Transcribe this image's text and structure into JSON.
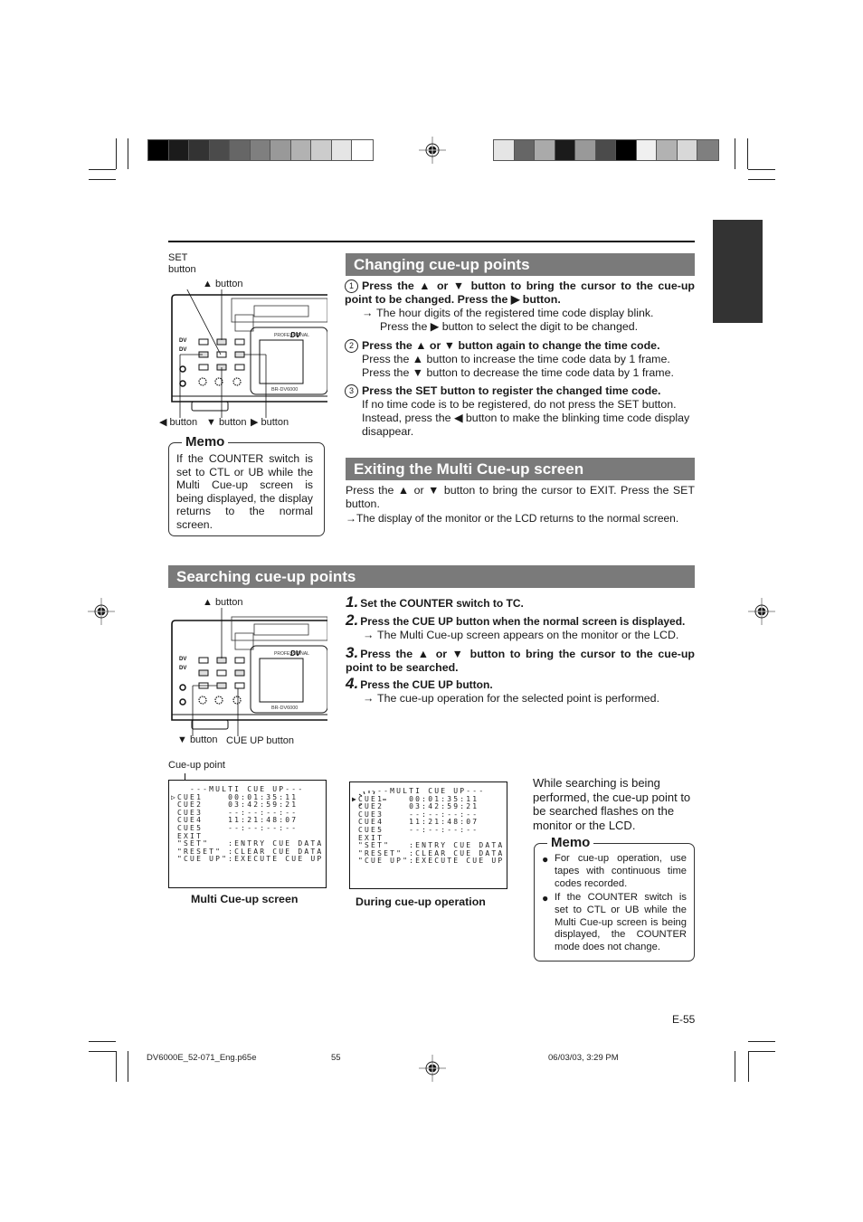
{
  "swatches_left": [
    "#000000",
    "#1b1b1b",
    "#333333",
    "#4b4b4b",
    "#666666",
    "#7f7f7f",
    "#999999",
    "#b2b2b2",
    "#cccccc",
    "#e5e5e5",
    "#ffffff"
  ],
  "swatches_right": [
    "#e5e5e5",
    "#666666",
    "#aaaaaa",
    "#1b1b1b",
    "#999999",
    "#4b4b4b",
    "#000000",
    "#f0f0f0",
    "#b2b2b2",
    "#d8d8d8",
    "#7f7f7f"
  ],
  "changing": {
    "title": "Changing cue-up points",
    "diagram": {
      "set_label_line1": "SET",
      "set_label_line2": "button",
      "up_label": "▲ button",
      "left_label": "◀ button",
      "down_label": "▼ button",
      "right_label": "▶ button",
      "brand": "DV",
      "model": "BR-DV6000"
    },
    "steps": [
      {
        "marker": "1",
        "bold": "Press the ▲ or ▼ button to bring the cursor to the cue-up point to be changed. Press the ▶ button.",
        "lines": [
          {
            "arrow": true,
            "text": "The hour digits of the registered time code display blink."
          },
          {
            "arrow": false,
            "text": "Press the ▶ button to select the digit to be changed."
          }
        ]
      },
      {
        "marker": "2",
        "bold": "Press the ▲ or ▼ button again to change the time code.",
        "lines": [
          {
            "arrow": false,
            "text": "Press the ▲ button to increase the time code data by 1 frame."
          },
          {
            "arrow": false,
            "text": "Press the ▼ button to decrease the time code data by 1 frame."
          }
        ]
      },
      {
        "marker": "3",
        "bold": "Press the SET button to register the changed time code.",
        "lines": [
          {
            "arrow": false,
            "text": "If no time code is to be registered, do not press the SET button. Instead, press the ◀ button to make the blinking time code display disappear."
          }
        ]
      }
    ],
    "memo": {
      "title": "Memo",
      "text": "If the COUNTER switch is set to CTL or UB while the Multi Cue-up screen is being displayed, the display returns to the normal screen."
    }
  },
  "exiting": {
    "title": "Exiting the Multi Cue-up screen",
    "text": "Press the ▲ or ▼ button to bring the cursor to EXIT. Press the SET button.",
    "result": "The display of the monitor or the LCD returns to the normal screen."
  },
  "searching": {
    "title": "Searching cue-up points",
    "diagram": {
      "up_label": "▲ button",
      "down_label": "▼ button",
      "cueup_label": "CUE UP button",
      "brand": "DV",
      "model": "BR-DV6000"
    },
    "steps": [
      {
        "num": "1.",
        "bold": "Set the COUNTER switch to TC.",
        "result": ""
      },
      {
        "num": "2.",
        "bold": "Press the CUE UP button when the normal screen is displayed.",
        "result": "The Multi Cue-up screen appears on the monitor or the LCD."
      },
      {
        "num": "3.",
        "bold": "Press the ▲ or ▼ button to bring the cursor to the cue-up point to be searched.",
        "result": ""
      },
      {
        "num": "4.",
        "bold": "Press the CUE UP button.",
        "result": "The cue-up operation for the selected point is performed."
      }
    ],
    "cue_point_label": "Cue-up point",
    "screen_rows": [
      "   ---MULTI CUE UP---",
      " CUE1    00:01:35:11",
      " CUE2    03:42:59:21",
      " CUE3    --:--:--:--",
      " CUE4    11:21:48:07",
      " CUE5    --:--:--:--",
      " EXIT",
      " \"SET\"   :ENTRY CUE DATA",
      " \"RESET\" :CLEAR CUE DATA",
      " \"CUE UP\":EXECUTE CUE UP"
    ],
    "screen1_caption": "Multi Cue-up screen",
    "screen2_caption": "During cue-up operation",
    "side_text": "While searching is being performed, the cue-up point to be searched flashes on the monitor or the LCD.",
    "memo": {
      "title": "Memo",
      "bullets": [
        "For cue-up operation, use tapes with continuous time codes recorded.",
        "If the COUNTER switch is set to CTL or UB while the Multi Cue-up screen is being displayed, the COUNTER mode does not change."
      ]
    }
  },
  "page_number": "E-55",
  "footer": {
    "file": "DV6000E_52-071_Eng.p65e",
    "page": "55",
    "date": "06/03/03, 3:29 PM"
  }
}
